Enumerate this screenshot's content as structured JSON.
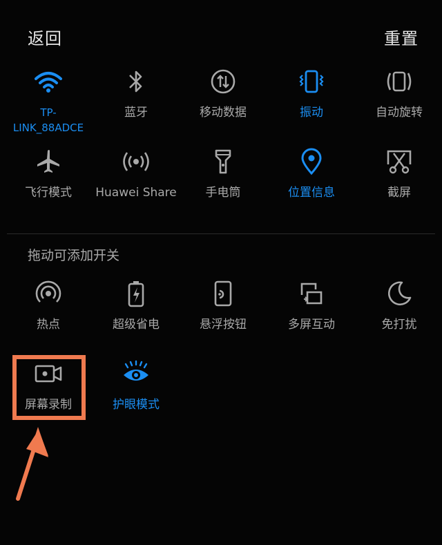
{
  "header": {
    "back_label": "返回",
    "reset_label": "重置"
  },
  "active_tiles": [
    {
      "id": "wifi",
      "label": "TP-\nLINK_88ADCE",
      "icon": "wifi-icon",
      "active": true
    },
    {
      "id": "bluetooth",
      "label": "蓝牙",
      "icon": "bluetooth-icon",
      "active": false
    },
    {
      "id": "mobile-data",
      "label": "移动数据",
      "icon": "mobile-data-icon",
      "active": false
    },
    {
      "id": "vibrate",
      "label": "振动",
      "icon": "vibrate-icon",
      "active": true
    },
    {
      "id": "auto-rotate",
      "label": "自动旋转",
      "icon": "auto-rotate-icon",
      "active": false
    },
    {
      "id": "airplane",
      "label": "飞行模式",
      "icon": "airplane-icon",
      "active": false
    },
    {
      "id": "huawei-share",
      "label": "Huawei Share",
      "icon": "huawei-share-icon",
      "active": false
    },
    {
      "id": "flashlight",
      "label": "手电筒",
      "icon": "flashlight-icon",
      "active": false
    },
    {
      "id": "location",
      "label": "位置信息",
      "icon": "location-icon",
      "active": true
    },
    {
      "id": "screenshot",
      "label": "截屏",
      "icon": "screenshot-icon",
      "active": false
    }
  ],
  "add_section": {
    "title": "拖动可添加开关",
    "tiles": [
      {
        "id": "hotspot",
        "label": "热点",
        "icon": "hotspot-icon",
        "active": false
      },
      {
        "id": "ultra-power",
        "label": "超级省电",
        "icon": "battery-saver-icon",
        "active": false
      },
      {
        "id": "floating-button",
        "label": "悬浮按钮",
        "icon": "floating-button-icon",
        "active": false
      },
      {
        "id": "multi-screen",
        "label": "多屏互动",
        "icon": "multi-screen-icon",
        "active": false
      },
      {
        "id": "do-not-disturb",
        "label": "免打扰",
        "icon": "moon-icon",
        "active": false
      },
      {
        "id": "screen-record",
        "label": "屏幕录制",
        "icon": "screen-record-icon",
        "active": false
      },
      {
        "id": "eye-comfort",
        "label": "护眼模式",
        "icon": "eye-icon",
        "active": true
      }
    ]
  },
  "colors": {
    "accent": "#1b8ef2",
    "inactive": "#a9a9a9",
    "highlight": "#f07a4f",
    "background": "#050505"
  }
}
